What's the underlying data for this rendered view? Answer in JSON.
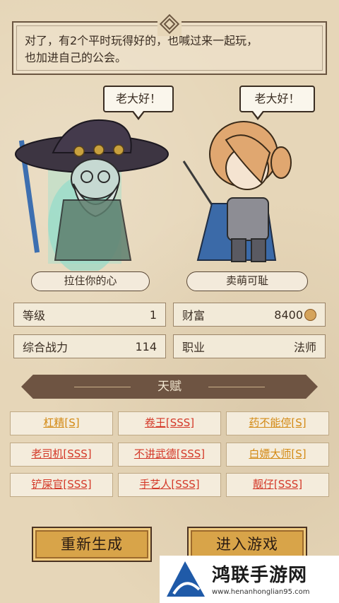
{
  "dialog": {
    "line1": "对了，有2个平时玩得好的，也喊过来一起玩，",
    "line2": "也加进自己的公会。"
  },
  "characters": {
    "left": {
      "speech": "老大好！",
      "name": "拉住你的心"
    },
    "right": {
      "speech": "老大好！",
      "name": "卖萌可耻"
    }
  },
  "stats": [
    {
      "label": "等级",
      "value": "1"
    },
    {
      "label": "财富",
      "value": "8400"
    },
    {
      "label": "综合战力",
      "value": "114"
    },
    {
      "label": "职业",
      "value": "法师"
    }
  ],
  "talent": {
    "title": "天赋",
    "items": [
      {
        "label": "杠精[S]",
        "color": "#d38a15"
      },
      {
        "label": "卷王[SSS]",
        "color": "#d43828"
      },
      {
        "label": "药不能停[S]",
        "color": "#d38a15"
      },
      {
        "label": "老司机[SSS]",
        "color": "#d43828"
      },
      {
        "label": "不讲武德[SSS]",
        "color": "#d43828"
      },
      {
        "label": "白嫖大师[S]",
        "color": "#d38a15"
      },
      {
        "label": "铲屎官[SSS]",
        "color": "#d43828"
      },
      {
        "label": "手艺人[SSS]",
        "color": "#d43828"
      },
      {
        "label": "靓仔[SSS]",
        "color": "#d43828"
      }
    ]
  },
  "buttons": {
    "regenerate": "重新生成",
    "enter_game": "进入游戏"
  },
  "watermark": {
    "title": "鸿联手游网",
    "url": "www.henanhonglian95.com"
  },
  "icons": {
    "wealth": "coin-icon",
    "dialog": "ornament-icon"
  }
}
